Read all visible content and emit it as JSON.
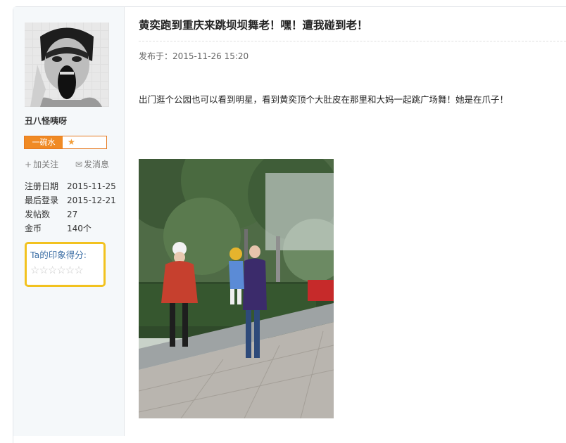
{
  "user": {
    "name": "丑八怪咦呀",
    "rank_label": "一碗水",
    "rank_star": "★",
    "follow_label": "加关注",
    "message_label": "发消息",
    "stats": [
      {
        "key": "注册日期",
        "value": "2015-11-25"
      },
      {
        "key": "最后登录",
        "value": "2015-12-21"
      },
      {
        "key": "发帖数",
        "value": "27"
      },
      {
        "key": "金币",
        "value": "140个"
      }
    ],
    "impression_title": "Ta的印象得分:",
    "impression_stars": "☆☆☆☆☆☆"
  },
  "post": {
    "title": "黄奕跑到重庆来跳坝坝舞老！嘿！遭我碰到老！",
    "time": "发布于：2015-11-26 15:20",
    "text": "出门逛个公园也可以看到明星，看到黄奕顶个大肚皮在那里和大妈一起跳广场舞！她是在爪子！"
  },
  "colors": {
    "rank_orange": "#f08a24",
    "impression_border": "#f2c21f",
    "link_blue": "#3b6ea5"
  },
  "icons": [
    "plus-icon",
    "envelope-icon",
    "star-icon"
  ]
}
